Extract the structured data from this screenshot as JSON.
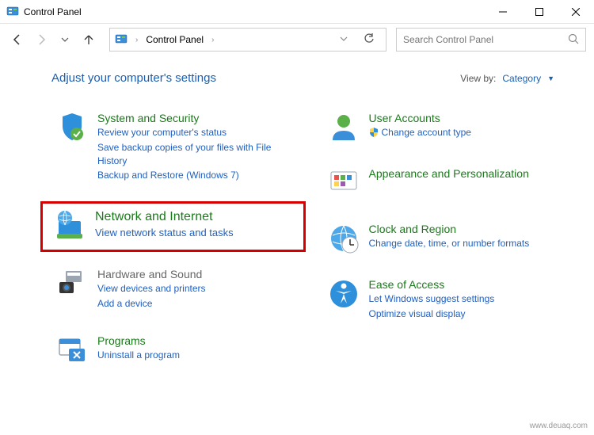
{
  "window": {
    "title": "Control Panel"
  },
  "address": {
    "location": "Control Panel"
  },
  "search": {
    "placeholder": "Search Control Panel"
  },
  "page": {
    "heading": "Adjust your computer's settings",
    "viewby_label": "View by:",
    "viewby_value": "Category"
  },
  "categories": {
    "system_security": {
      "title": "System and Security",
      "links": [
        "Review your computer's status",
        "Save backup copies of your files with File History",
        "Backup and Restore (Windows 7)"
      ]
    },
    "network_internet": {
      "title": "Network and Internet",
      "links": [
        "View network status and tasks"
      ]
    },
    "hardware_sound": {
      "title": "Hardware and Sound",
      "links": [
        "View devices and printers",
        "Add a device"
      ]
    },
    "programs": {
      "title": "Programs",
      "links": [
        "Uninstall a program"
      ]
    },
    "user_accounts": {
      "title": "User Accounts",
      "links": [
        "Change account type"
      ]
    },
    "appearance": {
      "title": "Appearance and Personalization"
    },
    "clock_region": {
      "title": "Clock and Region",
      "links": [
        "Change date, time, or number formats"
      ]
    },
    "ease_access": {
      "title": "Ease of Access",
      "links": [
        "Let Windows suggest settings",
        "Optimize visual display"
      ]
    }
  },
  "watermark": "www.deuaq.com"
}
